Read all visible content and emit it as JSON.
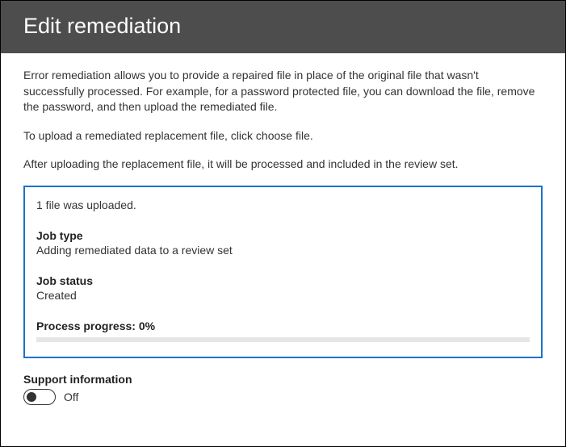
{
  "header": {
    "title": "Edit remediation"
  },
  "intro": {
    "paragraph1": "Error remediation allows you to provide a repaired file in place of the original file that wasn't successfully processed. For example, for a password protected file, you can download the file, remove the password, and then upload the remediated file.",
    "paragraph2": "To upload a remediated replacement file, click choose file.",
    "paragraph3": "After uploading the replacement file, it will be processed and included in the review set."
  },
  "status": {
    "upload_message": "1 file was uploaded.",
    "job_type_label": "Job type",
    "job_type_value": "Adding remediated data to a review set",
    "job_status_label": "Job status",
    "job_status_value": "Created",
    "progress_label": "Process progress: 0%",
    "progress_percent": 0
  },
  "support": {
    "label": "Support information",
    "state": "Off"
  }
}
